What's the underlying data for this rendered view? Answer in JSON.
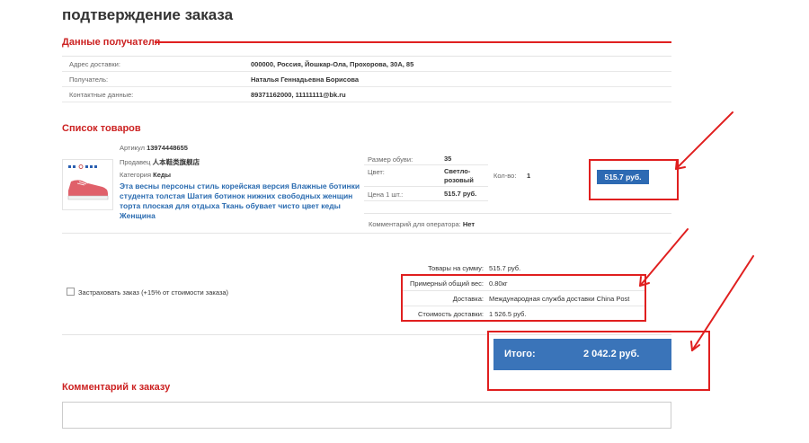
{
  "page": {
    "title": "подтверждение заказа"
  },
  "recipient": {
    "section_title": "Данные получателя",
    "rows": [
      {
        "label": "Адрес доставки:",
        "value": "000000, Россия, Йошкар-Ола, Прохорова, 30А, 85"
      },
      {
        "label": "Получатель:",
        "value": "Наталья Геннадьевна Борисова"
      },
      {
        "label": "Контактные данные:",
        "value": "89371162000, 11111111@bk.ru"
      }
    ]
  },
  "goods": {
    "section_title": "Список товаров",
    "item": {
      "article_label": "Артикул",
      "article": "13974448655",
      "seller_label": "Продавец",
      "seller": "人本鞋类旗舰店",
      "category_label": "Категория",
      "category": "Кеды",
      "title": "Эта весны персоны стиль корейская версия Влажные ботинки студента толстая Шатия ботинок нижних свободных женщин торта плоская для отдыха Ткань обувает чисто цвет кеды Женщина",
      "attributes": [
        {
          "label": "Размер обуви:",
          "value": "35"
        },
        {
          "label": "Цвет:",
          "value": "Светло-розовый"
        },
        {
          "label": "Цена 1 шт.:",
          "value": "515.7 руб."
        }
      ],
      "qty_label": "Кол-во:",
      "qty": "1",
      "line_total": "515.7 руб.",
      "comment_label": "Комментарий для оператора:",
      "comment": "Нет"
    }
  },
  "insurance": {
    "label": "Застраховать заказ (+15% от стоимости заказа)",
    "checked": false
  },
  "totals": {
    "rows": [
      {
        "label": "Товары на сумму:",
        "value": "515.7 руб."
      },
      {
        "label": "Примерный общий вес:",
        "value": "0.80кг"
      },
      {
        "label": "Доставка:",
        "value": "Международная служба доставки China Post"
      },
      {
        "label": "Стоимость доставки:",
        "value": "1 526.5 руб."
      }
    ],
    "grand_label": "Итого:",
    "grand_value": "2 042.2 руб."
  },
  "comment": {
    "section_title": "Комментарий к заказу",
    "value": ""
  },
  "colors": {
    "accent_red": "#e02020",
    "brand_blue": "#3a74b9",
    "link_blue": "#2a6bb0"
  }
}
